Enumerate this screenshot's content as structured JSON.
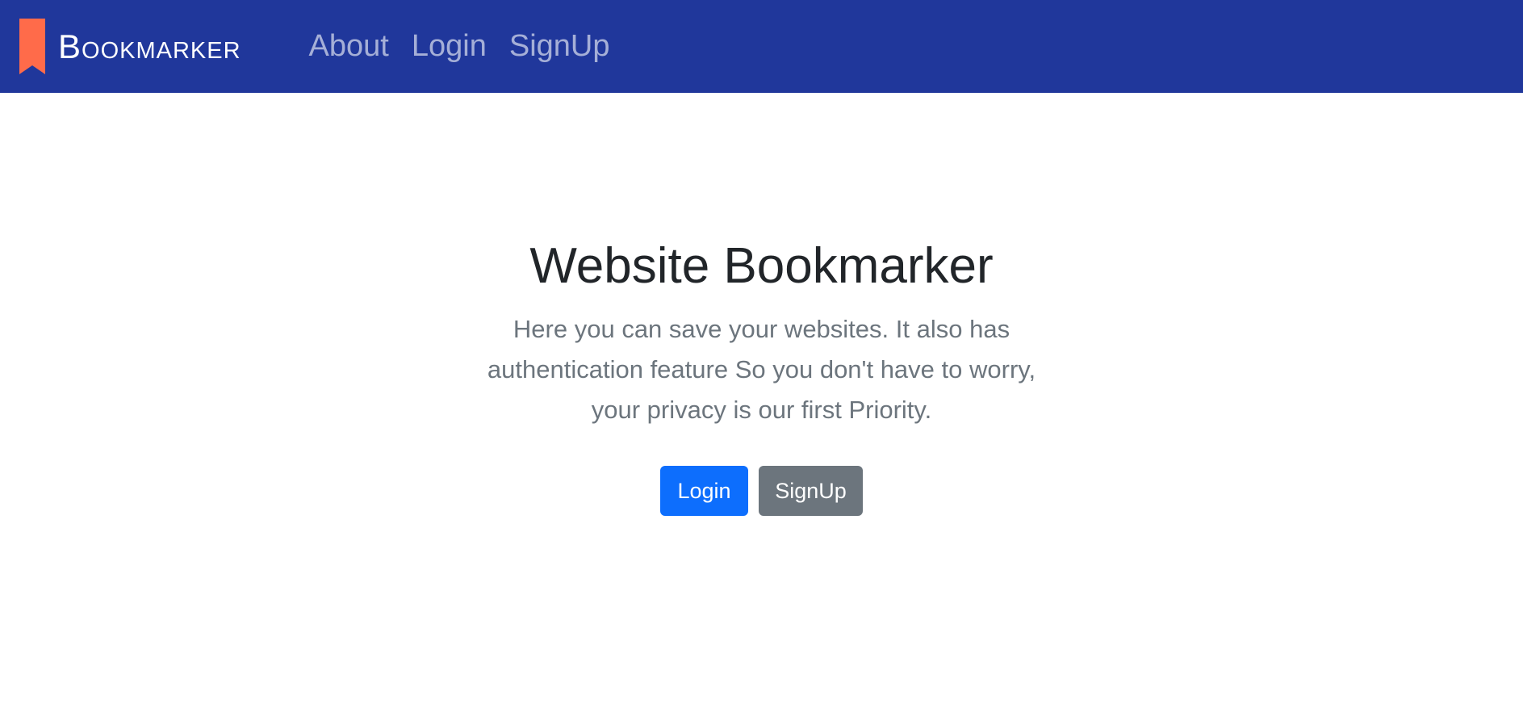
{
  "navbar": {
    "brand": "Bookmarker",
    "links": [
      "About",
      "Login",
      "SignUp"
    ],
    "background_color": "#20379b",
    "logo_color": "#ff6b4a",
    "logo_icon": "bookmark-icon"
  },
  "hero": {
    "title": "Website Bookmarker",
    "lead": "Here you can save your websites. It also has authentication feature So you don't have to worry, your privacy is our first Priority.",
    "buttons": {
      "login": "Login",
      "signup": "SignUp"
    },
    "button_colors": {
      "login": "#0d6efd",
      "signup": "#6c757d"
    }
  }
}
